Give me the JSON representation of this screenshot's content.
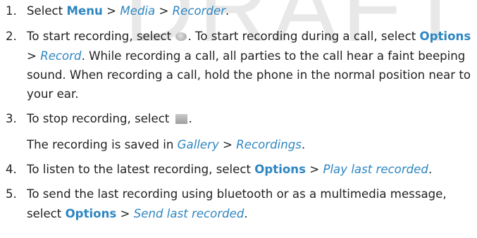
{
  "watermark": "DRAFT",
  "colors": {
    "link": "#2e86c1",
    "text": "#222222",
    "watermark": "#e8e8e8"
  },
  "steps": [
    {
      "num": "1.",
      "t1": "Select ",
      "menu": "Menu",
      "sep1": " > ",
      "media": "Media",
      "sep2": " > ",
      "recorder": "Recorder",
      "end": "."
    },
    {
      "num": "2.",
      "t1": "To start recording, select ",
      "icon": "record-circle-icon",
      "t2": ". To start recording during a call, select ",
      "options": "Options",
      "sep": " > ",
      "record": "Record",
      "t3": ". While recording a call, all parties to the call hear a faint beeping sound. When recording a call, hold the phone in the normal position near to your ear."
    },
    {
      "num": "3.",
      "t1": "To stop recording, select ",
      "icon": "stop-square-icon",
      "end": ".",
      "note_t1": "The recording is saved in ",
      "gallery": "Gallery",
      "sep": " > ",
      "recordings": "Recordings",
      "note_end": "."
    },
    {
      "num": "4.",
      "t1": "To listen to the latest recording, select ",
      "options": "Options",
      "sep": " > ",
      "play": "Play last recorded",
      "end": "."
    },
    {
      "num": "5.",
      "t1": "To send the last recording using bluetooth or as a multimedia message, select ",
      "options": "Options",
      "sep": " > ",
      "send": "Send last recorded",
      "end": "."
    }
  ]
}
